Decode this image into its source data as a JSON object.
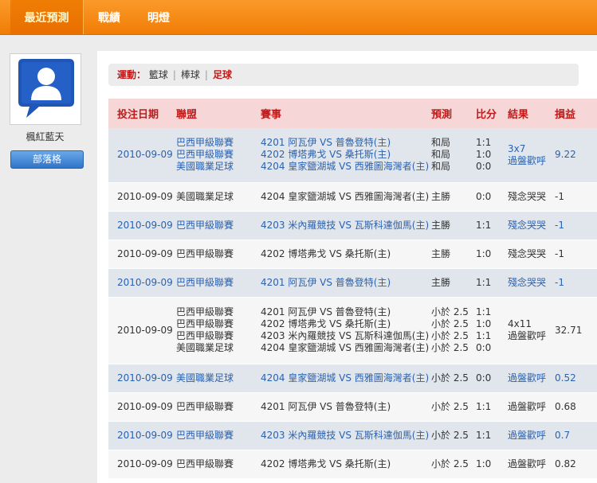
{
  "nav": {
    "tabs": [
      {
        "label": "最近預測",
        "active": true
      },
      {
        "label": "戰績",
        "active": false
      },
      {
        "label": "明燈",
        "active": false
      }
    ]
  },
  "sidebar": {
    "avatar_icon": "chat-user-icon",
    "username": "楓紅藍天",
    "blog_button": "部落格"
  },
  "filter": {
    "label": "運動：",
    "items": [
      "籃球",
      "棒球",
      "足球"
    ],
    "selected": "足球"
  },
  "table": {
    "headers": [
      "投注日期",
      "聯盟",
      "賽事",
      "預測",
      "比分",
      "結果",
      "損益"
    ],
    "rows": [
      {
        "style": "shaded",
        "date": "2010-09-09",
        "leagues": [
          "巴西甲級聯賽",
          "巴西甲級聯賽",
          "美國職業足球"
        ],
        "matches": [
          "4201 阿瓦伊 VS 普魯登特(主)",
          "4202 博塔弗戈 VS 桑托斯(主)",
          "4204 皇家鹽湖城 VS 西雅圖海灣者(主)"
        ],
        "predictions": [
          "和局",
          "和局",
          "和局"
        ],
        "scores": [
          "1:1",
          "1:0",
          "0:0"
        ],
        "result": [
          "3x7",
          "過盤歡呼"
        ],
        "result_type": "win",
        "profit": "9.22"
      },
      {
        "style": "plain",
        "date": "2010-09-09",
        "leagues": [
          "美國職業足球"
        ],
        "matches": [
          "4204 皇家鹽湖城 VS 西雅圖海灣者(主)"
        ],
        "predictions": [
          "主勝"
        ],
        "scores": [
          "0:0"
        ],
        "result": [
          "殘念哭哭"
        ],
        "result_type": "lose",
        "profit": "-1"
      },
      {
        "style": "shaded",
        "date": "2010-09-09",
        "leagues": [
          "巴西甲級聯賽"
        ],
        "matches": [
          "4203 米內羅競技 VS 瓦斯科達伽馬(主)"
        ],
        "predictions": [
          "主勝"
        ],
        "scores": [
          "1:1"
        ],
        "result": [
          "殘念哭哭"
        ],
        "result_type": "lose",
        "profit": "-1"
      },
      {
        "style": "plain",
        "date": "2010-09-09",
        "leagues": [
          "巴西甲級聯賽"
        ],
        "matches": [
          "4202 博塔弗戈 VS 桑托斯(主)"
        ],
        "predictions": [
          "主勝"
        ],
        "scores": [
          "1:0"
        ],
        "result": [
          "殘念哭哭"
        ],
        "result_type": "lose",
        "profit": "-1"
      },
      {
        "style": "shaded",
        "date": "2010-09-09",
        "leagues": [
          "巴西甲級聯賽"
        ],
        "matches": [
          "4201 阿瓦伊 VS 普魯登特(主)"
        ],
        "predictions": [
          "主勝"
        ],
        "scores": [
          "1:1"
        ],
        "result": [
          "殘念哭哭"
        ],
        "result_type": "lose",
        "profit": "-1"
      },
      {
        "style": "plain",
        "date": "2010-09-09",
        "leagues": [
          "巴西甲級聯賽",
          "巴西甲級聯賽",
          "巴西甲級聯賽",
          "美國職業足球"
        ],
        "matches": [
          "4201 阿瓦伊 VS 普魯登特(主)",
          "4202 博塔弗戈 VS 桑托斯(主)",
          "4203 米內羅競技 VS 瓦斯科達伽馬(主)",
          "4204 皇家鹽湖城 VS 西雅圖海灣者(主)"
        ],
        "predictions": [
          "小於 2.5",
          "小於 2.5",
          "小於 2.5",
          "小於 2.5"
        ],
        "scores": [
          "1:1",
          "1:0",
          "1:1",
          "0:0"
        ],
        "result": [
          "4x11",
          "過盤歡呼"
        ],
        "result_type": "win",
        "profit": "32.71"
      },
      {
        "style": "shaded",
        "date": "2010-09-09",
        "leagues": [
          "美國職業足球"
        ],
        "matches": [
          "4204 皇家鹽湖城 VS 西雅圖海灣者(主)"
        ],
        "predictions": [
          "小於 2.5"
        ],
        "scores": [
          "0:0"
        ],
        "result": [
          "過盤歡呼"
        ],
        "result_type": "win",
        "profit": "0.52"
      },
      {
        "style": "plain",
        "date": "2010-09-09",
        "leagues": [
          "巴西甲級聯賽"
        ],
        "matches": [
          "4201 阿瓦伊 VS 普魯登特(主)"
        ],
        "predictions": [
          "小於 2.5"
        ],
        "scores": [
          "1:1"
        ],
        "result": [
          "過盤歡呼"
        ],
        "result_type": "win",
        "profit": "0.68"
      },
      {
        "style": "shaded",
        "date": "2010-09-09",
        "leagues": [
          "巴西甲級聯賽"
        ],
        "matches": [
          "4203 米內羅競技 VS 瓦斯科達伽馬(主)"
        ],
        "predictions": [
          "小於 2.5"
        ],
        "scores": [
          "1:1"
        ],
        "result": [
          "過盤歡呼"
        ],
        "result_type": "win",
        "profit": "0.7"
      },
      {
        "style": "plain",
        "date": "2010-09-09",
        "leagues": [
          "巴西甲級聯賽"
        ],
        "matches": [
          "4202 博塔弗戈 VS 桑托斯(主)"
        ],
        "predictions": [
          "小於 2.5"
        ],
        "scores": [
          "1:0"
        ],
        "result": [
          "過盤歡呼"
        ],
        "result_type": "win",
        "profit": "0.82"
      }
    ]
  },
  "colors": {
    "nav_orange": "#f07d05",
    "header_red": "#c11a1a",
    "link_blue": "#2b62b0",
    "win_green": "#3f9f1f"
  }
}
